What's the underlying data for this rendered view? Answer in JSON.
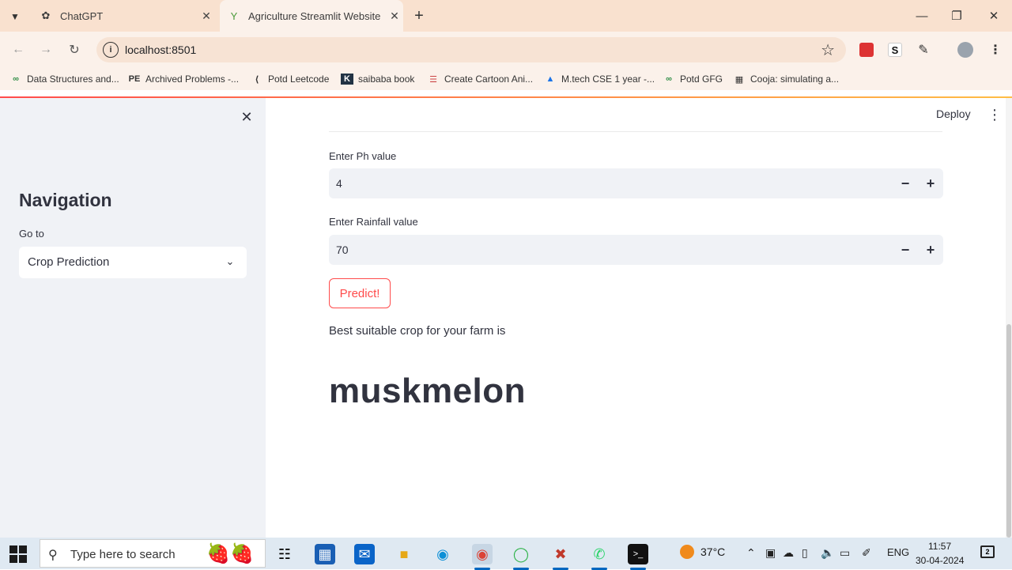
{
  "browser": {
    "tabs": [
      {
        "title": "ChatGPT",
        "active": false
      },
      {
        "title": "Agriculture Streamlit Website",
        "active": true
      }
    ],
    "url": "localhost:8501",
    "bookmarks": [
      "Data Structures and...",
      "Archived Problems -...",
      "Potd Leetcode",
      "saibaba book",
      "Create Cartoon Ani...",
      "M.tech CSE 1 year -...",
      "Potd GFG",
      "Cooja: simulating a..."
    ],
    "extension_labels": {
      "s": "S"
    }
  },
  "sidebar": {
    "title": "Navigation",
    "goto_label": "Go to",
    "selected": "Crop Prediction"
  },
  "header": {
    "deploy_label": "Deploy"
  },
  "form": {
    "ph": {
      "label": "Enter Ph value",
      "value": "4"
    },
    "rainfall": {
      "label": "Enter Rainfall value",
      "value": "70"
    },
    "predict_label": "Predict!"
  },
  "result": {
    "text": "Best suitable crop for your farm is",
    "crop": "muskmelon"
  },
  "taskbar": {
    "search_placeholder": "Type here to search",
    "weather": "37°C",
    "lang": "ENG",
    "time": "11:57",
    "date": "30-04-2024",
    "notification_count": "2"
  },
  "colors": {
    "accent": "#ff4b4b",
    "sidebar_bg": "#f0f2f6",
    "tabstrip_bg": "#f9e1cf",
    "text": "#31333f"
  }
}
